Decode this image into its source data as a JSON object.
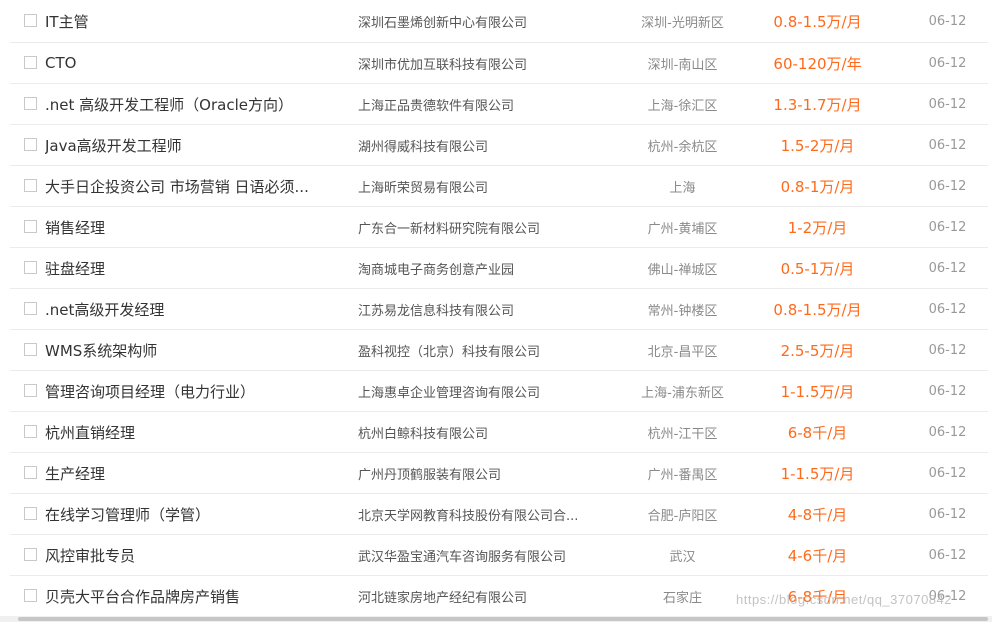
{
  "jobs": [
    {
      "title": "IT主管",
      "company": "深圳石墨烯创新中心有限公司",
      "area": "深圳-光明新区",
      "salary": "0.8-1.5万/月",
      "date": "06-12"
    },
    {
      "title": "CTO",
      "company": "深圳市优加互联科技有限公司",
      "area": "深圳-南山区",
      "salary": "60-120万/年",
      "date": "06-12"
    },
    {
      "title": ".net 高级开发工程师（Oracle方向）",
      "company": "上海正品贵德软件有限公司",
      "area": "上海-徐汇区",
      "salary": "1.3-1.7万/月",
      "date": "06-12"
    },
    {
      "title": "Java高级开发工程师",
      "company": "湖州得威科技有限公司",
      "area": "杭州-余杭区",
      "salary": "1.5-2万/月",
      "date": "06-12"
    },
    {
      "title": "大手日企投资公司 市场营销 日语必须...",
      "company": "上海昕荣贸易有限公司",
      "area": "上海",
      "salary": "0.8-1万/月",
      "date": "06-12"
    },
    {
      "title": "销售经理",
      "company": "广东合一新材料研究院有限公司",
      "area": "广州-黄埔区",
      "salary": "1-2万/月",
      "date": "06-12"
    },
    {
      "title": "驻盘经理",
      "company": "淘商城电子商务创意产业园",
      "area": "佛山-禅城区",
      "salary": "0.5-1万/月",
      "date": "06-12"
    },
    {
      "title": ".net高级开发经理",
      "company": "江苏易龙信息科技有限公司",
      "area": "常州-钟楼区",
      "salary": "0.8-1.5万/月",
      "date": "06-12"
    },
    {
      "title": "WMS系统架构师",
      "company": "盈科视控（北京）科技有限公司",
      "area": "北京-昌平区",
      "salary": "2.5-5万/月",
      "date": "06-12"
    },
    {
      "title": "管理咨询项目经理（电力行业）",
      "company": "上海惠卓企业管理咨询有限公司",
      "area": "上海-浦东新区",
      "salary": "1-1.5万/月",
      "date": "06-12"
    },
    {
      "title": "杭州直销经理",
      "company": "杭州白鲸科技有限公司",
      "area": "杭州-江干区",
      "salary": "6-8千/月",
      "date": "06-12"
    },
    {
      "title": "生产经理",
      "company": "广州丹顶鹤服装有限公司",
      "area": "广州-番禺区",
      "salary": "1-1.5万/月",
      "date": "06-12"
    },
    {
      "title": "在线学习管理师（学管）",
      "company": "北京天学网教育科技股份有限公司合...",
      "area": "合肥-庐阳区",
      "salary": "4-8千/月",
      "date": "06-12"
    },
    {
      "title": "风控审批专员",
      "company": "武汉华盈宝通汽车咨询服务有限公司",
      "area": "武汉",
      "salary": "4-6千/月",
      "date": "06-12"
    },
    {
      "title": "贝壳大平台合作品牌房产销售",
      "company": "河北链家房地产经纪有限公司",
      "area": "石家庄",
      "salary": "6-8千/月",
      "date": "06-12"
    }
  ],
  "watermark": "https://blog.csdn.net/qq_37070842"
}
